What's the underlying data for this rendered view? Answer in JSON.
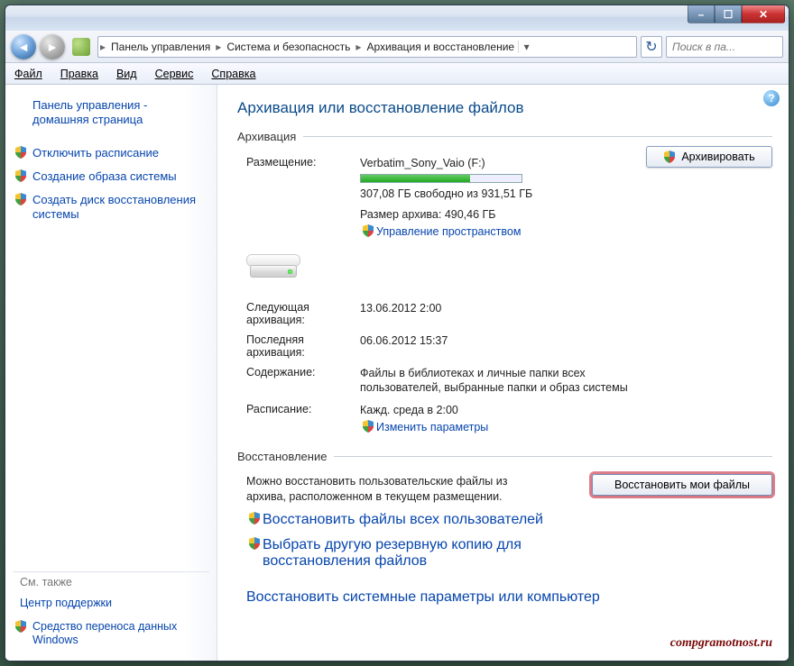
{
  "titlebar": {
    "min": "–",
    "max": "☐",
    "close": "✕"
  },
  "breadcrumbs": {
    "items": [
      "Панель управления",
      "Система и безопасность",
      "Архивация и восстановление"
    ],
    "sep": "▸",
    "dropdown": "▾"
  },
  "refresh_glyph": "↻",
  "search": {
    "placeholder": "Поиск в па..."
  },
  "menu": {
    "file": "Файл",
    "edit": "Правка",
    "view": "Вид",
    "tools": "Сервис",
    "help": "Справка"
  },
  "sidebar": {
    "home": "Панель управления - домашняя страница",
    "items": [
      "Отключить расписание",
      "Создание образа системы",
      "Создать диск восстановления системы"
    ],
    "see_also": "См. также",
    "support": "Центр поддержки",
    "easy_transfer": "Средство переноса данных Windows"
  },
  "main": {
    "title": "Архивация или восстановление файлов",
    "help_glyph": "?",
    "backup_legend": "Архивация",
    "restore_legend": "Восстановление",
    "location_label": "Размещение:",
    "location_value": "Verbatim_Sony_Vaio (F:)",
    "free_space": "307,08 ГБ свободно из 931,51 ГБ",
    "archive_size": "Размер архива: 490,46 ГБ",
    "manage_space": "Управление пространством",
    "next_label": "Следующая архивация:",
    "next_value": "13.06.2012 2:00",
    "last_label": "Последняя архивация:",
    "last_value": "06.06.2012 15:37",
    "content_label": "Содержание:",
    "content_value": "Файлы в библиотеках и личные папки всех пользователей, выбранные папки и образ системы",
    "schedule_label": "Расписание:",
    "schedule_value": "Кажд. среда в 2:00",
    "change_params": "Изменить параметры",
    "backup_button": "Архивировать",
    "restore_button": "Восстановить мои файлы",
    "restore_text": "Можно восстановить пользовательские файлы из архива, расположенном в текущем размещении.",
    "restore_all_users": "Восстановить файлы всех пользователей",
    "choose_other": "Выбрать другую резервную копию для восстановления файлов",
    "restore_system": "Восстановить системные параметры или компьютер",
    "progress_pct": "68%"
  },
  "credit": "compgramotnost.ru"
}
